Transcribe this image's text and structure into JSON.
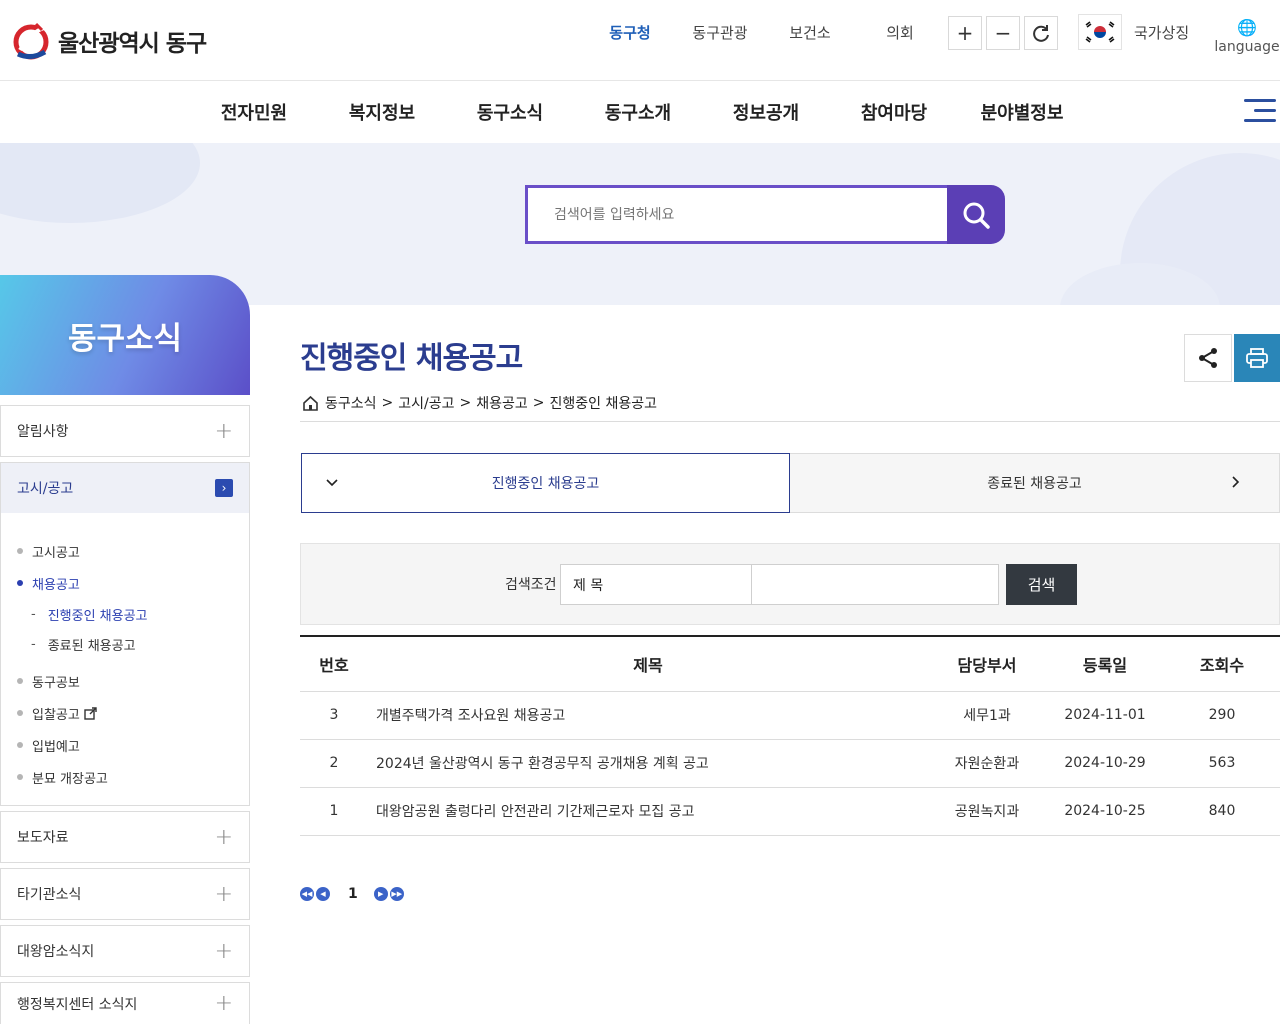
{
  "header": {
    "logo_text": "울산광역시 동구",
    "sites": [
      {
        "label": "동구청",
        "active": true
      },
      {
        "label": "동구관광",
        "active": false
      },
      {
        "label": "보건소",
        "active": false
      },
      {
        "label": "의회",
        "active": false
      }
    ],
    "zoom_in_label": "+",
    "zoom_out_label": "−",
    "symbol_label": "국가상징",
    "language_label": "language"
  },
  "gnb": {
    "items": [
      "전자민원",
      "복지정보",
      "동구소식",
      "동구소개",
      "정보공개",
      "참여마당",
      "분야별정보"
    ]
  },
  "search": {
    "placeholder": "검색어를 입력하세요"
  },
  "sidebar": {
    "title": "동구소식",
    "items": [
      {
        "label": "알림사항"
      },
      {
        "label": "고시/공고"
      },
      {
        "label": "보도자료"
      },
      {
        "label": "타기관소식"
      },
      {
        "label": "대왕암소식지"
      },
      {
        "label": "행정복지센터 소식지"
      }
    ],
    "sub_items": [
      {
        "label": "고시공고"
      },
      {
        "label": "채용공고"
      },
      {
        "label": "진행중인 채용공고"
      },
      {
        "label": "종료된 채용공고"
      },
      {
        "label": "동구공보"
      },
      {
        "label": "입찰공고"
      },
      {
        "label": "입법예고"
      },
      {
        "label": "분묘 개장공고"
      }
    ]
  },
  "main": {
    "title": "진행중인 채용공고",
    "breadcrumb": [
      "동구소식",
      "고시/공고",
      "채용공고",
      "진행중인 채용공고"
    ],
    "breadcrumb_sep": ">",
    "tabs": [
      {
        "label": "진행중인 채용공고",
        "active": true
      },
      {
        "label": "종료된 채용공고",
        "active": false
      }
    ],
    "search_form": {
      "label": "검색조건",
      "select_value": "제 목",
      "input_value": "",
      "button_label": "검색"
    },
    "table": {
      "headers": [
        "번호",
        "제목",
        "담당부서",
        "등록일",
        "조회수"
      ],
      "rows": [
        [
          "3",
          "개별주택가격 조사요원 채용공고",
          "세무1과",
          "2024-11-01",
          "290"
        ],
        [
          "2",
          "2024년 울산광역시 동구 환경공무직 공개채용 계획 공고",
          "자원순환과",
          "2024-10-29",
          "563"
        ],
        [
          "1",
          "대왕암공원 출렁다리 안전관리 기간제근로자 모집 공고",
          "공원녹지과",
          "2024-10-25",
          "840"
        ]
      ]
    },
    "pagination": {
      "current": "1"
    }
  },
  "colors": {
    "primary": "#2b3d8f",
    "search_accent": "#5b3fb5",
    "print_button": "#2a86b8",
    "active_site": "#1f5fb8"
  }
}
